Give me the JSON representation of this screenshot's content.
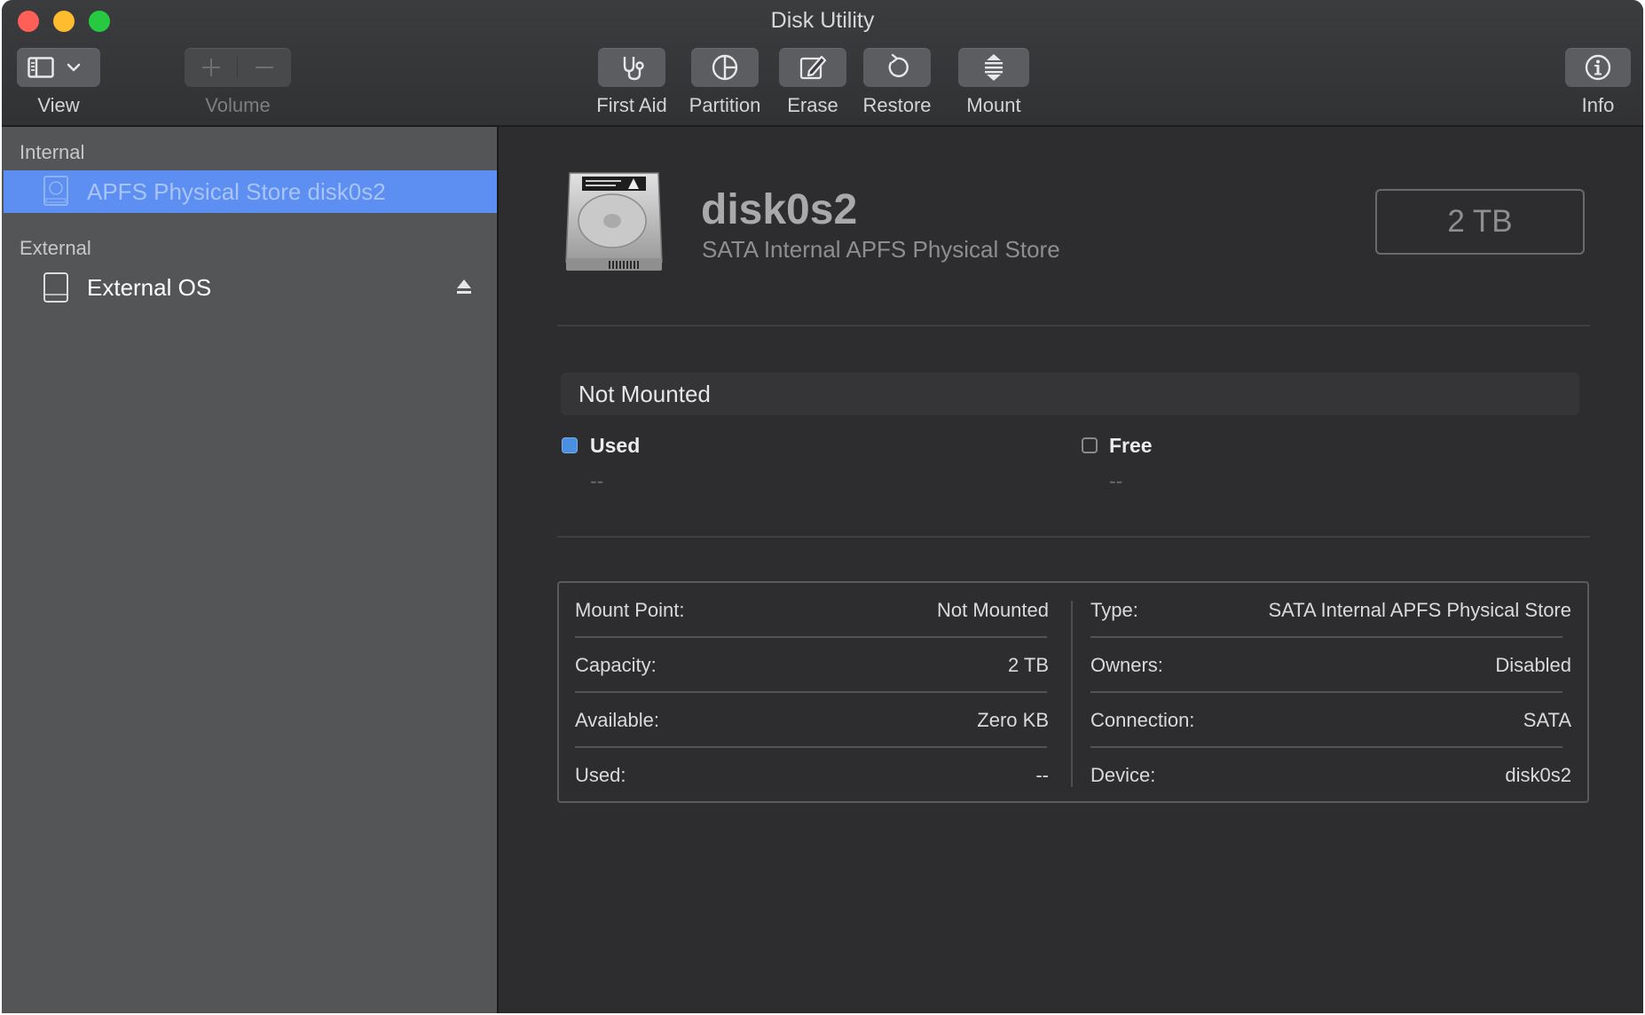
{
  "window": {
    "title": "Disk Utility"
  },
  "toolbar": {
    "view_label": "View",
    "volume_label": "Volume",
    "first_aid_label": "First Aid",
    "partition_label": "Partition",
    "erase_label": "Erase",
    "restore_label": "Restore",
    "mount_label": "Mount",
    "info_label": "Info"
  },
  "sidebar": {
    "internal_header": "Internal",
    "internal_items": [
      {
        "label": "APFS Physical Store disk0s2",
        "selected": true
      }
    ],
    "external_header": "External",
    "external_items": [
      {
        "label": "External OS",
        "ejectable": true
      }
    ]
  },
  "main": {
    "disk_name": "disk0s2",
    "disk_description": "SATA Internal APFS Physical Store",
    "capacity_badge": "2 TB",
    "mount_status": "Not Mounted",
    "legend": {
      "used_label": "Used",
      "used_value": "--",
      "free_label": "Free",
      "free_value": "--"
    },
    "details_left": [
      {
        "key": "Mount Point:",
        "value": "Not Mounted"
      },
      {
        "key": "Capacity:",
        "value": "2 TB"
      },
      {
        "key": "Available:",
        "value": "Zero KB"
      },
      {
        "key": "Used:",
        "value": "--"
      }
    ],
    "details_right": [
      {
        "key": "Type:",
        "value": "SATA Internal APFS Physical Store"
      },
      {
        "key": "Owners:",
        "value": "Disabled"
      },
      {
        "key": "Connection:",
        "value": "SATA"
      },
      {
        "key": "Device:",
        "value": "disk0s2"
      }
    ]
  },
  "colors": {
    "selection": "#5d8ef2",
    "used_legend": "#4a90e2",
    "close": "#ff5f57",
    "minimize": "#febc2e",
    "maximize": "#28c840"
  }
}
